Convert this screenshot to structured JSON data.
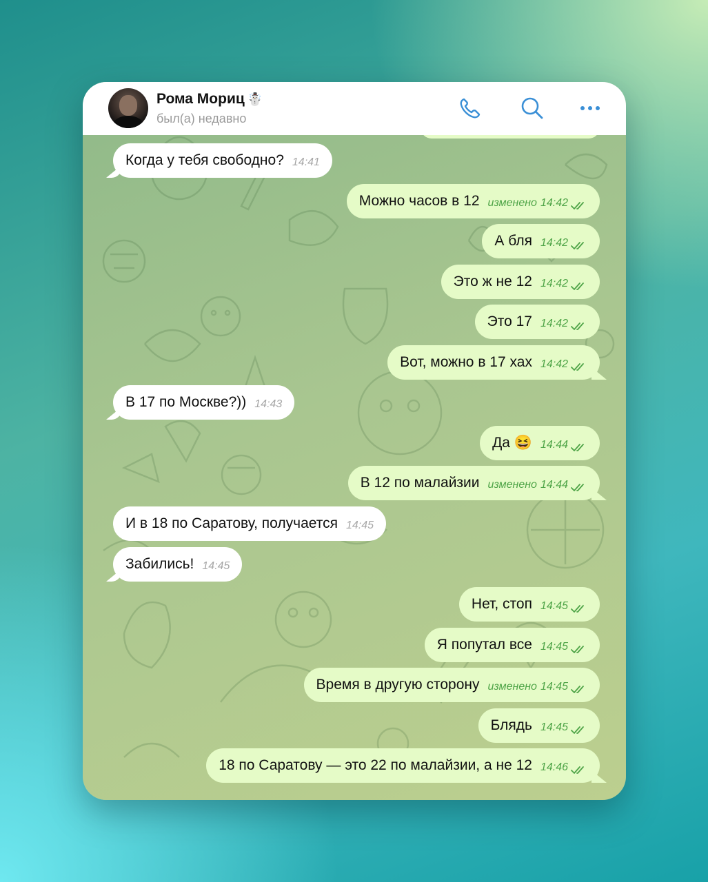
{
  "colors": {
    "incoming_bubble": "#ffffff",
    "outgoing_bubble": "#e5fbc7",
    "accent": "#3a8fd6",
    "time_out": "#4ea447"
  },
  "header": {
    "contact_name": "Рома Мориц",
    "name_emoji": "☃️",
    "status": "был(а) недавно",
    "icons": [
      "phone-icon",
      "search-icon",
      "more-icon"
    ]
  },
  "messages": [
    {
      "dir": "in",
      "text": "Когда у тебя свободно?",
      "time": "14:41",
      "edited": "",
      "tail": true
    },
    {
      "dir": "out",
      "text": "Можно часов в 12",
      "time": "14:42",
      "edited": "изменено",
      "tail": false
    },
    {
      "dir": "out",
      "text": "А бля",
      "time": "14:42",
      "edited": "",
      "tail": false
    },
    {
      "dir": "out",
      "text": "Это ж не 12",
      "time": "14:42",
      "edited": "",
      "tail": false
    },
    {
      "dir": "out",
      "text": "Это 17",
      "time": "14:42",
      "edited": "",
      "tail": false
    },
    {
      "dir": "out",
      "text": "Вот, можно в 17 хах",
      "time": "14:42",
      "edited": "",
      "tail": true
    },
    {
      "dir": "in",
      "text": "В 17 по Москве?))",
      "time": "14:43",
      "edited": "",
      "tail": true
    },
    {
      "dir": "out",
      "text": "Да 😆",
      "time": "14:44",
      "edited": "",
      "tail": false
    },
    {
      "dir": "out",
      "text": "В 12 по малайзии",
      "time": "14:44",
      "edited": "изменено",
      "tail": true
    },
    {
      "dir": "in",
      "text": "И в 18 по Саратову, получается",
      "time": "14:45",
      "edited": "",
      "tail": false
    },
    {
      "dir": "in",
      "text": "Забились!",
      "time": "14:45",
      "edited": "",
      "tail": true
    },
    {
      "dir": "out",
      "text": "Нет, стоп",
      "time": "14:45",
      "edited": "",
      "tail": false
    },
    {
      "dir": "out",
      "text": "Я попутал все",
      "time": "14:45",
      "edited": "",
      "tail": false
    },
    {
      "dir": "out",
      "text": "Время в другую сторону",
      "time": "14:45",
      "edited": "изменено",
      "tail": false
    },
    {
      "dir": "out",
      "text": "Блядь",
      "time": "14:45",
      "edited": "",
      "tail": false
    },
    {
      "dir": "out",
      "text": "18 по Саратову — это 22 по малайзии, а не 12",
      "time": "14:46",
      "edited": "",
      "tail": true
    }
  ]
}
